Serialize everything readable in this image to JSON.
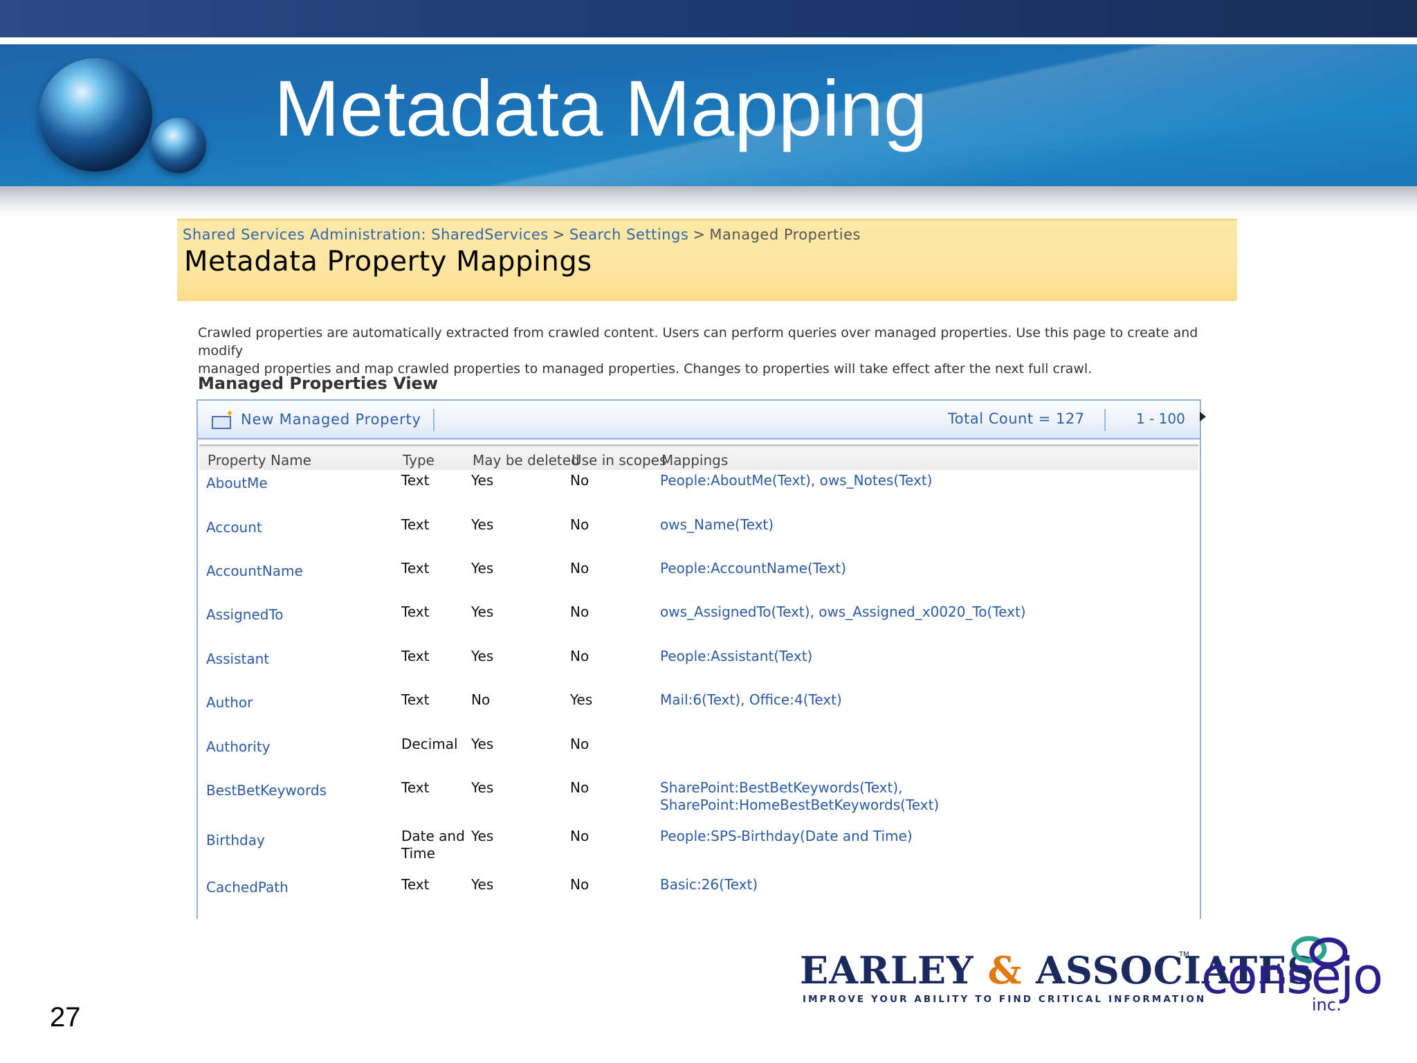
{
  "slide": {
    "title": "Metadata Mapping",
    "page_number": "27"
  },
  "screenshot": {
    "breadcrumb": {
      "item1": "Shared Services Administration: SharedServices",
      "item2": "Search Settings",
      "current": "Managed Properties",
      "separator": ">"
    },
    "page_title": "Metadata Property Mappings",
    "description_line1": "Crawled properties are automatically extracted from crawled content. Users can perform queries over managed properties. Use this page to create and modify",
    "description_line2": "managed properties and map crawled properties to managed properties. Changes to properties will take effect after the next full crawl.",
    "view_heading": "Managed Properties View",
    "toolbar": {
      "new_button": "New Managed Property",
      "total_count": "Total Count = 127",
      "paging": "1 - 100"
    },
    "columns": [
      "Property Name",
      "Type",
      "May be deleted",
      "Use in scopes",
      "Mappings"
    ],
    "rows": [
      {
        "name": "AboutMe",
        "type1": "Text",
        "type2": "",
        "deletable": "Yes",
        "scopes": "No",
        "map1": "People:AboutMe(Text), ows_Notes(Text)",
        "map2": ""
      },
      {
        "name": "Account",
        "type1": "Text",
        "type2": "",
        "deletable": "Yes",
        "scopes": "No",
        "map1": "ows_Name(Text)",
        "map2": ""
      },
      {
        "name": "AccountName",
        "type1": "Text",
        "type2": "",
        "deletable": "Yes",
        "scopes": "No",
        "map1": "People:AccountName(Text)",
        "map2": ""
      },
      {
        "name": "AssignedTo",
        "type1": "Text",
        "type2": "",
        "deletable": "Yes",
        "scopes": "No",
        "map1": "ows_AssignedTo(Text), ows_Assigned_x0020_To(Text)",
        "map2": ""
      },
      {
        "name": "Assistant",
        "type1": "Text",
        "type2": "",
        "deletable": "Yes",
        "scopes": "No",
        "map1": "People:Assistant(Text)",
        "map2": ""
      },
      {
        "name": "Author",
        "type1": "Text",
        "type2": "",
        "deletable": "No",
        "scopes": "Yes",
        "map1": "Mail:6(Text), Office:4(Text)",
        "map2": ""
      },
      {
        "name": "Authority",
        "type1": "Decimal",
        "type2": "",
        "deletable": "Yes",
        "scopes": "No",
        "map1": "",
        "map2": ""
      },
      {
        "name": "BestBetKeywords",
        "type1": "Text",
        "type2": "",
        "deletable": "Yes",
        "scopes": "No",
        "map1": "SharePoint:BestBetKeywords(Text),",
        "map2": "SharePoint:HomeBestBetKeywords(Text)"
      },
      {
        "name": "Birthday",
        "type1": "Date and",
        "type2": "Time",
        "deletable": "Yes",
        "scopes": "No",
        "map1": "People:SPS-Birthday(Date and Time)",
        "map2": ""
      },
      {
        "name": "CachedPath",
        "type1": "Text",
        "type2": "",
        "deletable": "Yes",
        "scopes": "No",
        "map1": "Basic:26(Text)",
        "map2": ""
      }
    ]
  },
  "logos": {
    "earley_name_part1": "EARLEY",
    "earley_amp": "&",
    "earley_name_part2": "ASSOCIATES",
    "earley_tm": "TM",
    "earley_tagline": "IMPROVE YOUR ABILITY TO FIND CRITICAL INFORMATION",
    "consejo_name": "consejo",
    "consejo_suffix": "inc."
  },
  "colors": {
    "banner_blue": "#1b6fb5",
    "title_area_yellow": "#fde6a1",
    "link_blue": "#2b5aa3",
    "logo_navy": "#1a2a5e",
    "logo_orange": "#e07a10",
    "consejo_purple": "#2a1f8c"
  }
}
